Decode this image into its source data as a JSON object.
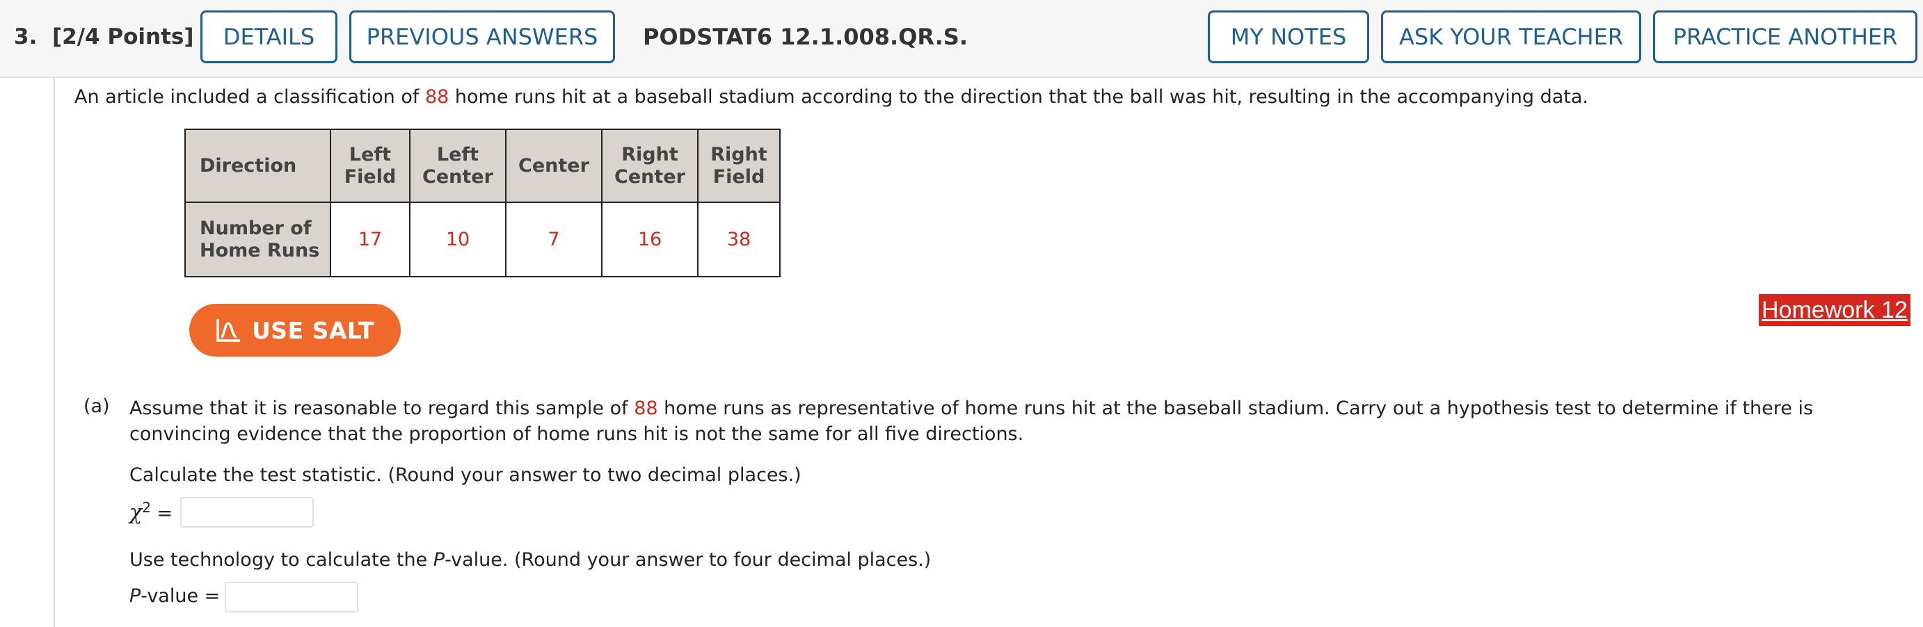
{
  "header": {
    "question_number": "3.",
    "points": "[2/4 Points]",
    "details_label": "DETAILS",
    "previous_answers_label": "PREVIOUS ANSWERS",
    "problem_code": "PODSTAT6 12.1.008.QR.S.",
    "my_notes_label": "MY NOTES",
    "ask_teacher_label": "ASK YOUR TEACHER",
    "practice_another_label": "PRACTICE ANOTHER"
  },
  "intro": {
    "before": "An article included a classification of ",
    "count": "88",
    "after": " home runs hit at a baseball stadium according to the direction that the ball was hit, resulting in the accompanying data."
  },
  "table": {
    "header_row": "Direction",
    "columns": [
      [
        "Left",
        "Field"
      ],
      [
        "Left",
        "Center"
      ],
      [
        "Center"
      ],
      [
        "Right",
        "Center"
      ],
      [
        "Right",
        "Field"
      ]
    ],
    "data_row": [
      "Number of",
      "Home Runs"
    ],
    "values": [
      "17",
      "10",
      "7",
      "16",
      "38"
    ]
  },
  "salt_label": "USE SALT",
  "homework_link": "Homework 12",
  "part_a": {
    "label": "(a)",
    "text_before": "Assume that it is reasonable to regard this sample of ",
    "count": "88",
    "text_after": " home runs as representative of home runs hit at the baseball stadium. Carry out a hypothesis test to determine if there is convincing evidence that the proportion of home runs hit is not the same for all five directions.",
    "instruction_stat": "Calculate the test statistic. (Round your answer to two decimal places.)",
    "chi_symbol": "χ",
    "chi_exponent": "2",
    "equals": "=",
    "chi_value": "",
    "instruction_p_before": "Use technology to calculate the ",
    "p_italic": "P",
    "instruction_p_after": "-value. (Round your answer to four decimal places.)",
    "p_label_rest": "-value =",
    "p_value": ""
  },
  "colors": {
    "accent_blue": "#1f5f8f",
    "data_red": "#d6271f",
    "salt_orange": "#ef6a2a",
    "table_header_bg": "#d9d5ce"
  }
}
